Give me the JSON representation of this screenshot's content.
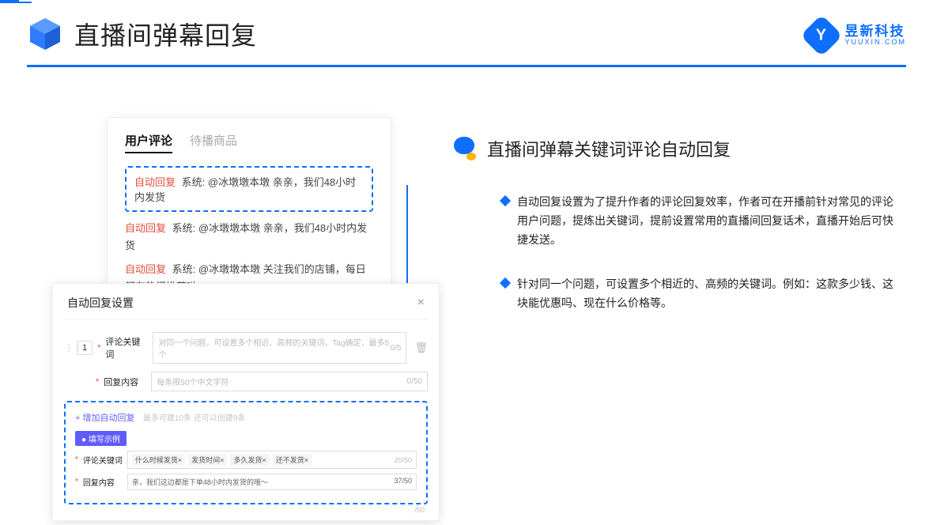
{
  "header": {
    "title": "直播间弹幕回复",
    "brand_cn": "昱新科技",
    "brand_en": "YUUXIN.COM",
    "brand_mark": "Y"
  },
  "card1": {
    "tab_active": "用户评论",
    "tab_other": "待播商品",
    "auto_tag": "自动回复",
    "sys_label": "系统:",
    "comment_hl": "@冰墩墩本墩 亲亲，我们48小时内发货",
    "comment2": "@冰墩墩本墩 亲亲，我们48小时内发货",
    "comment3": "@冰墩墩本墩 关注我们的店铺，每日都有热门推荐呦～"
  },
  "card2": {
    "title": "自动回复设置",
    "num": "1",
    "lbl_kw": "评论关键词",
    "kw_placeholder": "对同一个问题，可设置多个相近、高频的关键词，Tag确定，最多5个",
    "kw_counter": "0/5",
    "lbl_reply": "回复内容",
    "reply_placeholder": "每条限50个中文字符",
    "reply_counter": "0/50",
    "add_link": "+ 增加自动回复",
    "add_hint": "最多可建10条 还可以创建9条",
    "ex_badge": "● 填写示例",
    "ex_lbl_kw": "评论关键词",
    "ex_tags": [
      "什么时候发货×",
      "发货时间×",
      "多久发货×",
      "还不发货×"
    ],
    "ex_kw_cnt": "20/50",
    "ex_lbl_reply": "回复内容",
    "ex_reply": "亲，我们这边都是下单48小时内发货的哦～",
    "ex_reply_cnt": "37/50",
    "bottom_cnt": "/50"
  },
  "right": {
    "title": "直播间弹幕关键词评论自动回复",
    "bullet1": "自动回复设置为了提升作者的评论回复效率，作者可在开播前针对常见的评论用户问题，提炼出关键词，提前设置常用的直播间回复话术，直播开始后可快捷发送。",
    "bullet2": "针对同一个问题，可设置多个相近的、高频的关键词。例如：这款多少钱、这块能优惠吗、现在什么价格等。"
  }
}
